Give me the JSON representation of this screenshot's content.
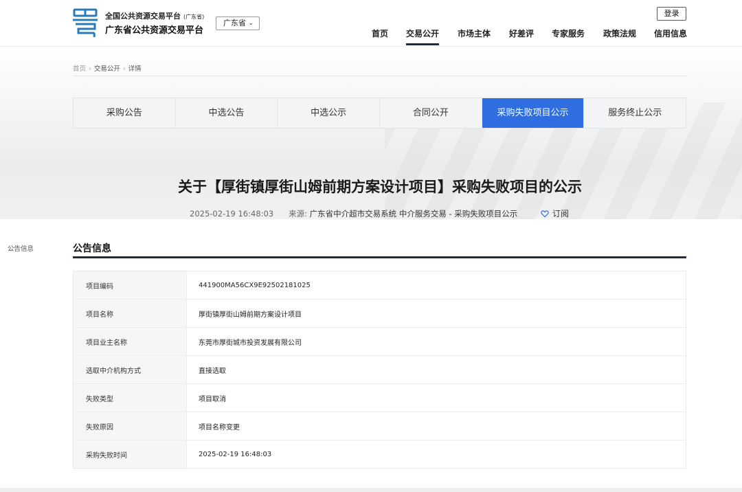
{
  "header": {
    "brand_top": "全国公共资源交易平台",
    "brand_top_tag": "(广东省)",
    "brand_main": "广东省公共资源交易平台",
    "province_select": "广东省",
    "login_label": "登录",
    "nav": [
      "首页",
      "交易公开",
      "市场主体",
      "好差评",
      "专家服务",
      "政策法规",
      "信用信息"
    ],
    "active_nav": "交易公开"
  },
  "breadcrumb": [
    "首页",
    "交易公开",
    "详情"
  ],
  "tabs": [
    "采购公告",
    "中选公告",
    "中选公示",
    "合同公开",
    "采购失败项目公示",
    "服务终止公示"
  ],
  "active_tab": "采购失败项目公示",
  "notice": {
    "title": "关于【厚街镇厚街山姆前期方案设计项目】采购失败项目的公示",
    "datetime": "2025-02-19 16:48:03",
    "source_label": "来源:",
    "source_value": "广东省中介超市交易系统 中介服务交易 - 采购失败项目公示",
    "subscribe_label": "订阅"
  },
  "side_label": "公告信息",
  "section_title": "公告信息",
  "info_rows": [
    {
      "key": "项目编码",
      "value": "441900MA56CX9E92502181025"
    },
    {
      "key": "项目名称",
      "value": "厚街镇厚街山姆前期方案设计项目"
    },
    {
      "key": "项目业主名称",
      "value": "东莞市厚街城市投资发展有限公司"
    },
    {
      "key": "选取中介机构方式",
      "value": "直接选取"
    },
    {
      "key": "失败类型",
      "value": "项目取消"
    },
    {
      "key": "失败原因",
      "value": "项目名称变更"
    },
    {
      "key": "采购失败时间",
      "value": "2025-02-19 16:48:03"
    }
  ],
  "colors": {
    "accent": "#2f6ee0",
    "nav_underline": "#1a2a44",
    "logo": "#2a7ab8"
  },
  "icons": {
    "logo": "yue-logo-icon",
    "select": "chevron-down-icon",
    "subscribe": "heart-icon"
  }
}
